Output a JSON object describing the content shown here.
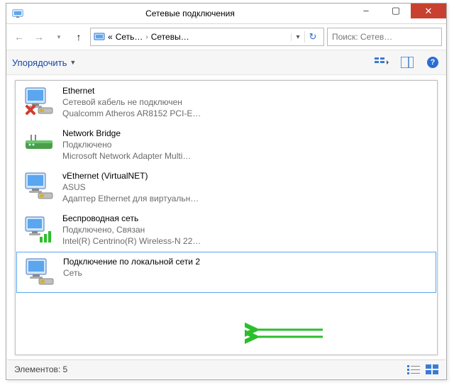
{
  "window": {
    "title": "Сетевые подключения",
    "min_label": "–",
    "max_label": "▢",
    "close_label": "✕"
  },
  "nav": {
    "back_icon": "←",
    "fwd_icon": "→",
    "up_icon": "↑",
    "breadcrumb_prefix": "«",
    "breadcrumb_1": "Сеть…",
    "breadcrumb_2": "Сетевы…",
    "breadcrumb_sep": "›",
    "dropdown_icon": "▾",
    "refresh_icon": "↻"
  },
  "search": {
    "placeholder": "Поиск: Сетев…",
    "icon": "🔍"
  },
  "toolbar": {
    "organize_label": "Упорядочить",
    "organize_dd": "▼"
  },
  "connections": [
    {
      "name": "Ethernet",
      "status": "Сетевой кабель не подключен",
      "device": "Qualcomm Atheros AR8152 PCI-E…",
      "icon": "nic-unplugged",
      "selected": false
    },
    {
      "name": "Network Bridge",
      "status": "Подключено",
      "device": "Microsoft Network Adapter Multi…",
      "icon": "bridge",
      "selected": false
    },
    {
      "name": "vEthernet (VirtualNET)",
      "status": "ASUS",
      "device": "Адаптер Ethernet для виртуальн…",
      "icon": "nic",
      "selected": false
    },
    {
      "name": "Беспроводная сеть",
      "status": "Подключено, Связан",
      "device": "Intel(R) Centrino(R) Wireless-N 22…",
      "icon": "wifi",
      "selected": false
    },
    {
      "name": "Подключение по локальной сети 2",
      "status": "",
      "device": "Сеть",
      "icon": "nic",
      "selected": true
    }
  ],
  "statusbar": {
    "count_label": "Элементов:",
    "count_value": "5"
  },
  "icons": {
    "app": "🖥",
    "view_list": "☰",
    "view_details": "▤"
  }
}
